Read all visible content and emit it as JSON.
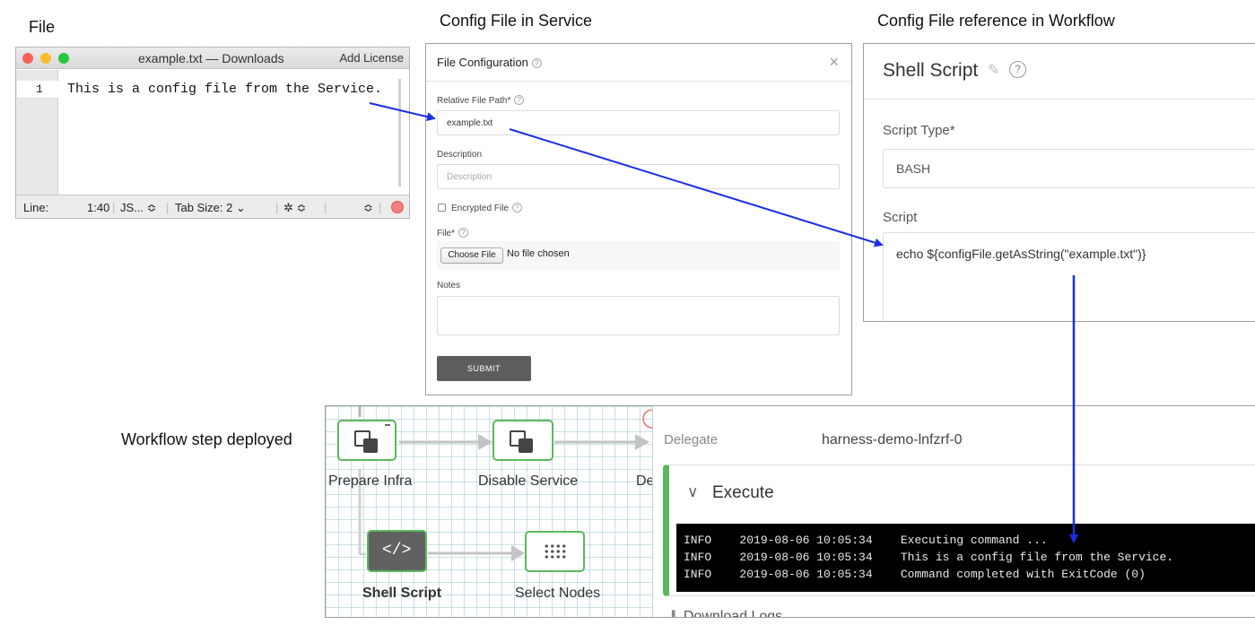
{
  "captions": {
    "file": "File",
    "config_in_service": "Config File in Service",
    "config_in_workflow": "Config File reference in Workflow",
    "workflow_deployed": "Workflow step deployed"
  },
  "editor": {
    "title": "example.txt — Downloads",
    "add_license": "Add License",
    "line_number": "1",
    "code": "This is a config file from the Service.",
    "status": {
      "line_label": "Line:",
      "position": "1:40",
      "syntax": "JS... ≎",
      "tab_size": "Tab Size:  2 ⌄",
      "gear": "✲ ≎",
      "spacer": "≎"
    },
    "traffic_colors": [
      "#fc5f57",
      "#fdbc2e",
      "#28c840"
    ]
  },
  "dialog": {
    "title": "File Configuration",
    "relative_path_label": "Relative File Path*",
    "relative_path_value": "example.txt",
    "description_label": "Description",
    "description_placeholder": "Description",
    "encrypted_label": "Encrypted File",
    "file_label": "File*",
    "choose_file": "Choose File",
    "no_file": "No file chosen",
    "notes_label": "Notes",
    "submit": "SUBMIT"
  },
  "shell": {
    "title": "Shell Script",
    "script_type_label": "Script Type*",
    "script_type_value": "BASH",
    "script_label": "Script",
    "script_value": "echo ${configFile.getAsString(\"example.txt\")}"
  },
  "workflow": {
    "nodes": {
      "prepare_infra": "Prepare Infra",
      "disable_service": "Disable Service",
      "truncated": "De",
      "shell_script": "Shell Script",
      "select_nodes": "Select Nodes"
    },
    "delegate_label": "Delegate",
    "delegate_value": "harness-demo-lnfzrf-0",
    "execute": "Execute",
    "logs": [
      "INFO    2019-08-06 10:05:34    Executing command ...",
      "INFO    2019-08-06 10:05:34    This is a config file from the Service.",
      "INFO    2019-08-06 10:05:34    Command completed with ExitCode (0)"
    ],
    "download_logs": "Download Logs"
  },
  "colors": {
    "arrow": "#1a2ee6",
    "success": "#5cb85c"
  }
}
